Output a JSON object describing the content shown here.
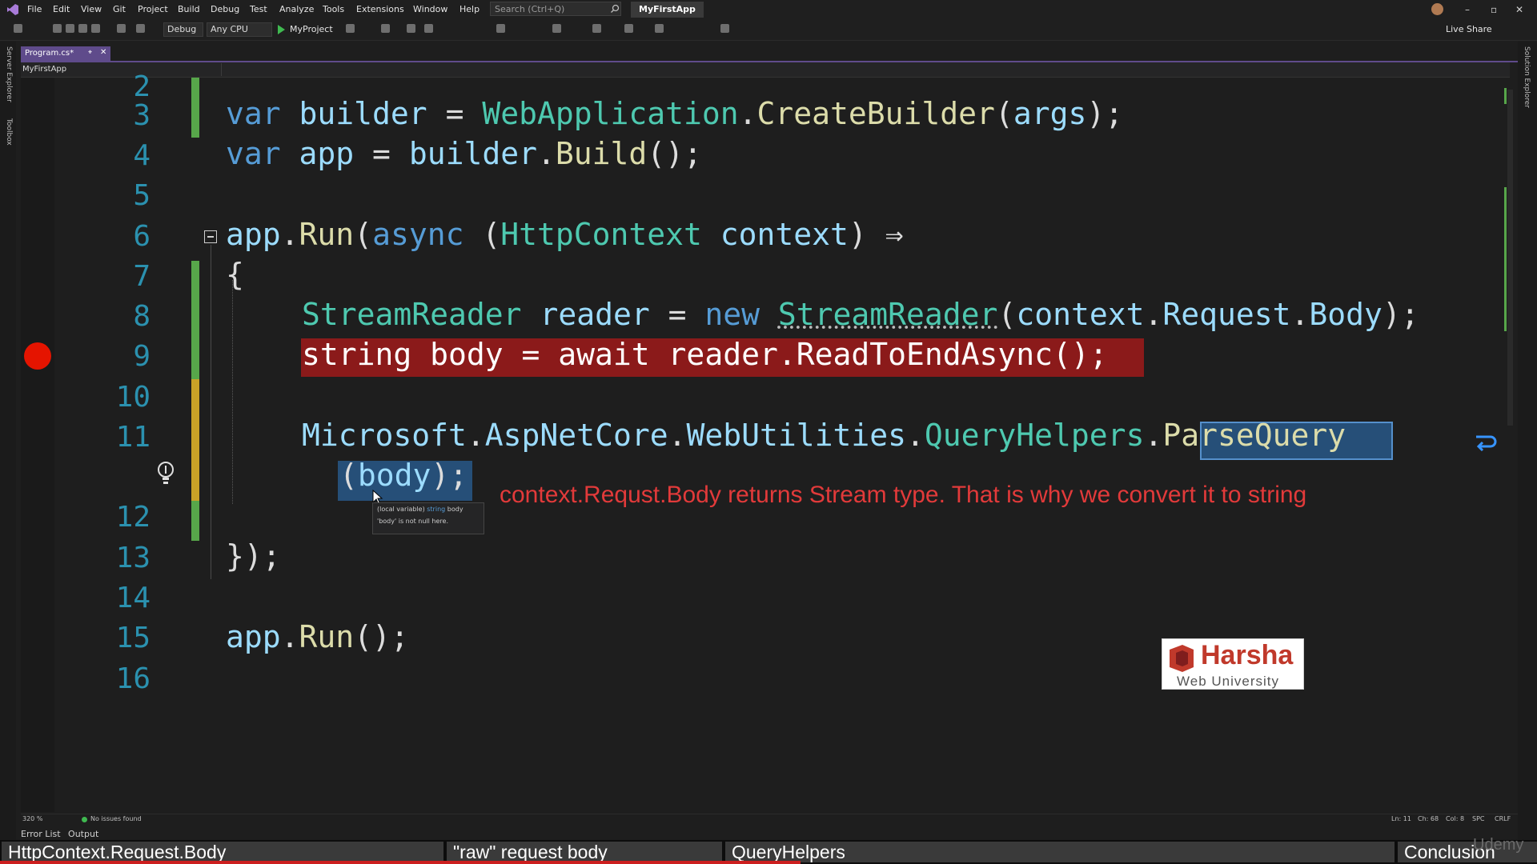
{
  "menu": {
    "items": [
      "File",
      "Edit",
      "View",
      "Git",
      "Project",
      "Build",
      "Debug",
      "Test",
      "Analyze",
      "Tools",
      "Extensions",
      "Window",
      "Help"
    ],
    "search_placeholder": "Search (Ctrl+Q)",
    "app_title": "MyFirstApp"
  },
  "toolbar": {
    "configuration": "Debug",
    "platform": "Any CPU",
    "run_target": "MyProject",
    "live_share": "Live Share"
  },
  "side_tabs": {
    "left": [
      "Server Explorer",
      "Toolbox"
    ],
    "right": [
      "Solution Explorer"
    ]
  },
  "document_tab": {
    "label": "Program.cs*"
  },
  "nav": {
    "project": "MyFirstApp"
  },
  "editor": {
    "line_numbers": [
      "2",
      "3",
      "4",
      "5",
      "6",
      "7",
      "8",
      "9",
      "10",
      "11",
      "12",
      "13",
      "14",
      "15",
      "16"
    ],
    "breakpoint_line": 9,
    "tooltip": {
      "kind": "(local variable)",
      "type": "string",
      "name": "body",
      "note": "'body' is not null here."
    }
  },
  "annotation": "context.Requst.Body returns Stream type. That is why we convert it to string",
  "logo": {
    "name": "Harsha",
    "subtitle": "Web University"
  },
  "status": {
    "zoom": "320 %",
    "issues": "No issues found",
    "line": "Ln: 11",
    "char": "Ch: 68",
    "col": "Col: 8",
    "spc": "SPC",
    "eol": "CRLF",
    "panels": [
      "Error List",
      "Output"
    ]
  },
  "chapters": [
    {
      "label": "HttpContext.Request.Body"
    },
    {
      "label": "\"raw\" request body"
    },
    {
      "label": "QueryHelpers"
    },
    {
      "label": "Conclusion"
    }
  ],
  "watermark": "Udemy",
  "colors": {
    "keyword": "#569cd6",
    "type": "#4ec9b0",
    "method": "#dcdcaa",
    "variable": "#9cdcfe",
    "breakpoint": "#e51400",
    "annotation": "#e23a3a",
    "chapter_progress": "#cc1f1f"
  }
}
